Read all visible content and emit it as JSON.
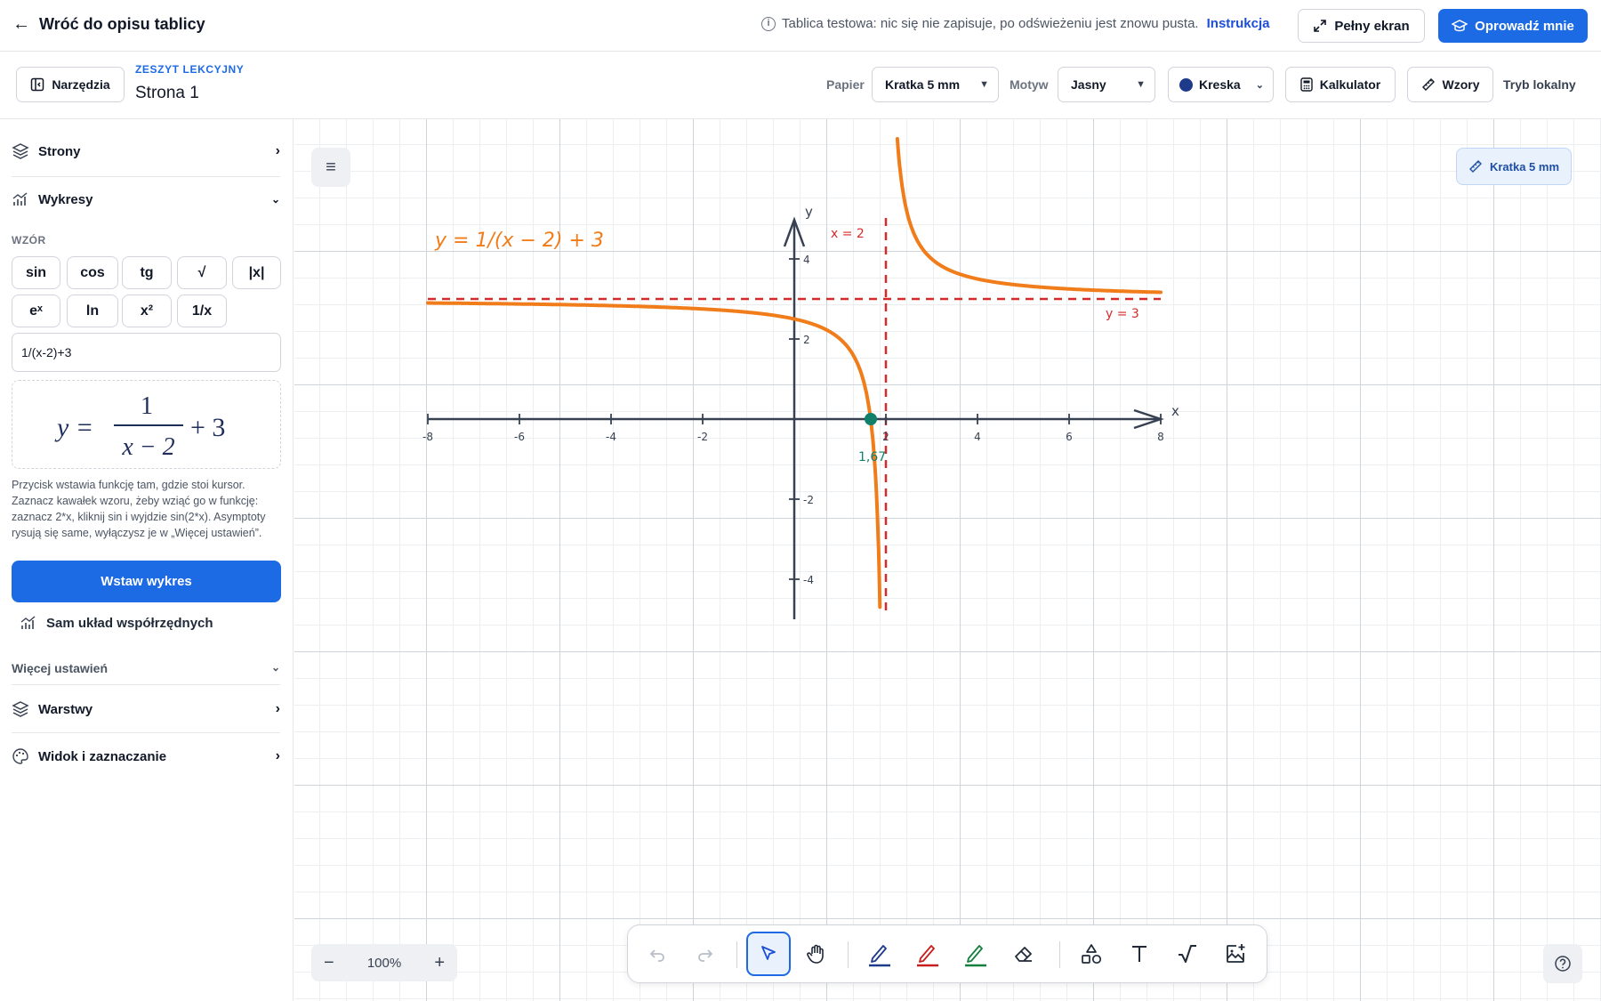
{
  "topbar": {
    "back_label": "Wróć do opisu tablicy",
    "info_text": "Tablica testowa: nic się nie zapisuje, po odświeżeniu jest znowu pusta.",
    "info_link": "Instrukcja",
    "fullscreen_label": "Pełny ekran",
    "guide_label": "Oprowadź mnie"
  },
  "toolbar": {
    "tools_label": "Narzędzia",
    "notebook_eyebrow": "ZESZYT LEKCYJNY",
    "page_name": "Strona 1",
    "paper_label": "Papier",
    "paper_value": "Kratka 5 mm",
    "theme_label": "Motyw",
    "theme_value": "Jasny",
    "pen_label": "Kreska",
    "pen_color": "#1e3a8a",
    "calculator_label": "Kalkulator",
    "formulas_label": "Wzory",
    "local_mode_label": "Tryb lokalny"
  },
  "sidebar": {
    "pages_label": "Strony",
    "graphs_label": "Wykresy",
    "formula_label": "WZÓR",
    "function_buttons": [
      "sin",
      "cos",
      "tg",
      "√",
      "|x|",
      "eˣ",
      "ln",
      "x²",
      "1/x"
    ],
    "formula_input_value": "1/(x-2)+3",
    "preview": {
      "lhs": "y =",
      "numerator": "1",
      "denominator": "x − 2",
      "tail": "+ 3"
    },
    "help_text": "Przycisk wstawia funkcję tam, gdzie stoi kursor. Zaznacz kawałek wzoru, żeby wziąć go w funkcję: zaznacz 2*x, kliknij sin i wyjdzie sin(2*x). Asymptoty rysują się same, wyłączysz je w „Więcej ustawień”.",
    "insert_label": "Wstaw wykres",
    "axes_only_label": "Sam układ współrzędnych",
    "more_settings_label": "Więcej ustawień",
    "layers_label": "Warstwy",
    "view_label": "Widok i zaznaczanie"
  },
  "canvas": {
    "paper_chip": "Kratka 5 mm",
    "zoom_value": "100%"
  },
  "graph": {
    "function_label": "y = 1/(x − 2) + 3",
    "x_axis_label": "x",
    "y_axis_label": "y",
    "x_ticks": [
      -8,
      -6,
      -4,
      -2,
      2,
      4,
      6,
      8
    ],
    "y_ticks": [
      4,
      2,
      -2,
      -4
    ],
    "xlim": [
      -8,
      8
    ],
    "ylim": [
      -5,
      5
    ],
    "vertical_asymptote": {
      "x": 2,
      "label": "x = 2"
    },
    "horizontal_asymptote": {
      "y": 3,
      "label": "y = 3"
    },
    "root": {
      "x": 1.67,
      "label": "1,67"
    },
    "curve_color": "#f07c1a",
    "asymptote_color": "#d42a2a",
    "axis_color": "#374151",
    "root_color": "#11806a"
  }
}
